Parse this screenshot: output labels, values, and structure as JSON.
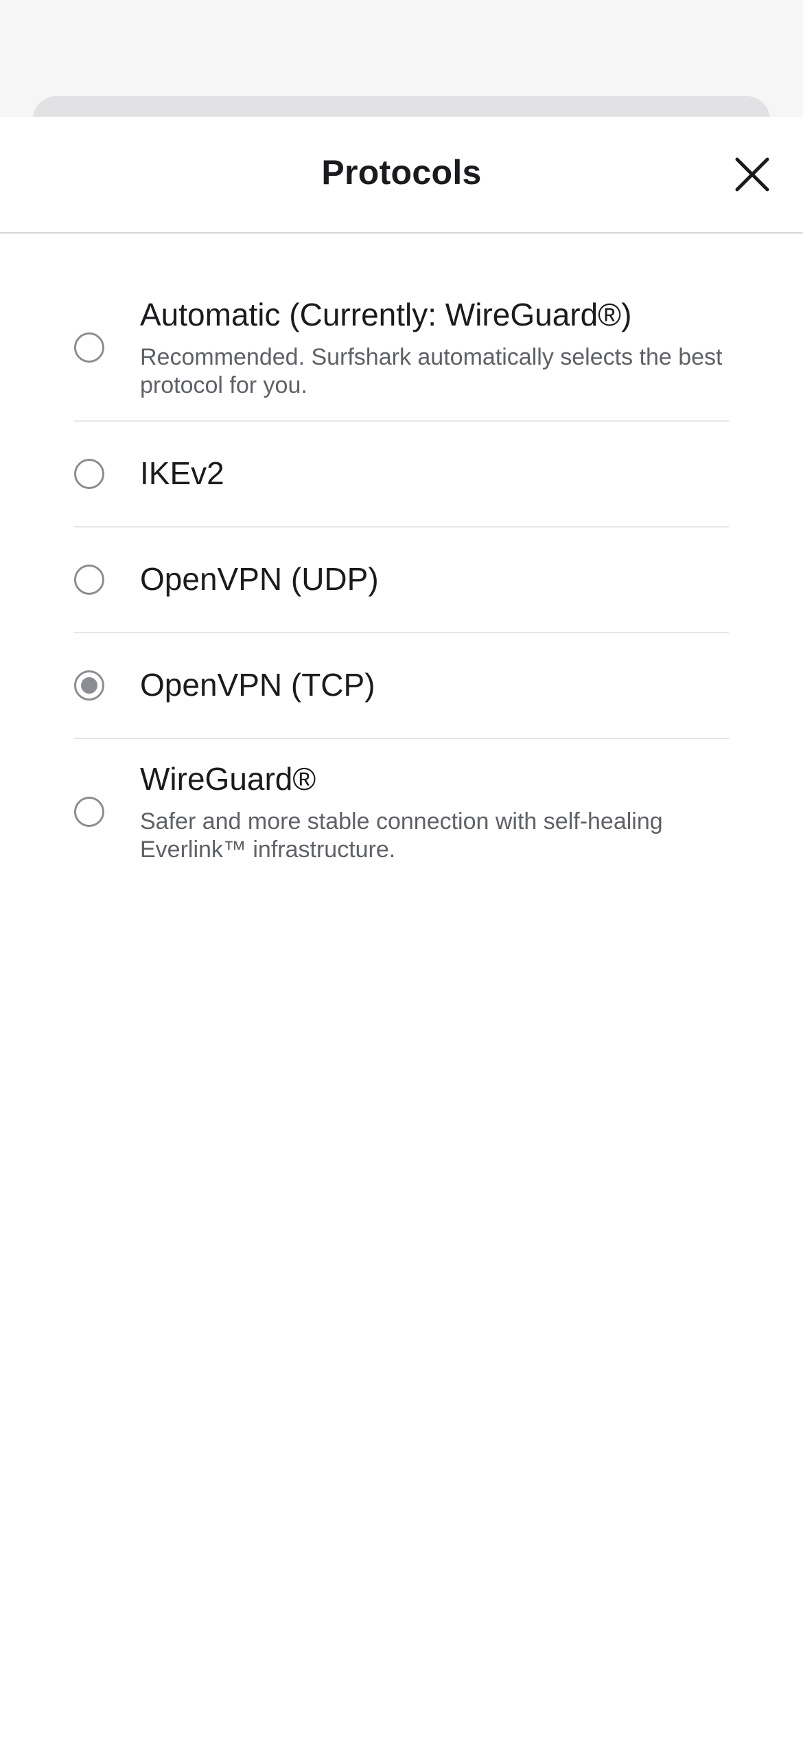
{
  "header": {
    "title": "Protocols",
    "close_icon": "close-icon"
  },
  "protocols": {
    "selected": "OpenVPN (TCP)",
    "options": [
      {
        "title": "Automatic (Currently: WireGuard®)",
        "description": "Recommended. Surfshark automatically selects the best protocol for you.",
        "checked": false
      },
      {
        "title": "IKEv2",
        "description": "",
        "checked": false
      },
      {
        "title": "OpenVPN (UDP)",
        "description": "",
        "checked": false
      },
      {
        "title": "OpenVPN (TCP)",
        "description": "",
        "checked": true
      },
      {
        "title": "WireGuard®",
        "description": "Safer and more stable connection with self-healing Everlink™ infrastructure.",
        "checked": false
      }
    ]
  },
  "colors": {
    "radio": "#8c8c93",
    "title_text": "#1b1b1f",
    "description_text": "#5f6168",
    "divider": "#e6e6e9",
    "background": "#ffffff",
    "backdrop": "#f6f6f7",
    "sheet_peek": "#e2e2e4"
  }
}
